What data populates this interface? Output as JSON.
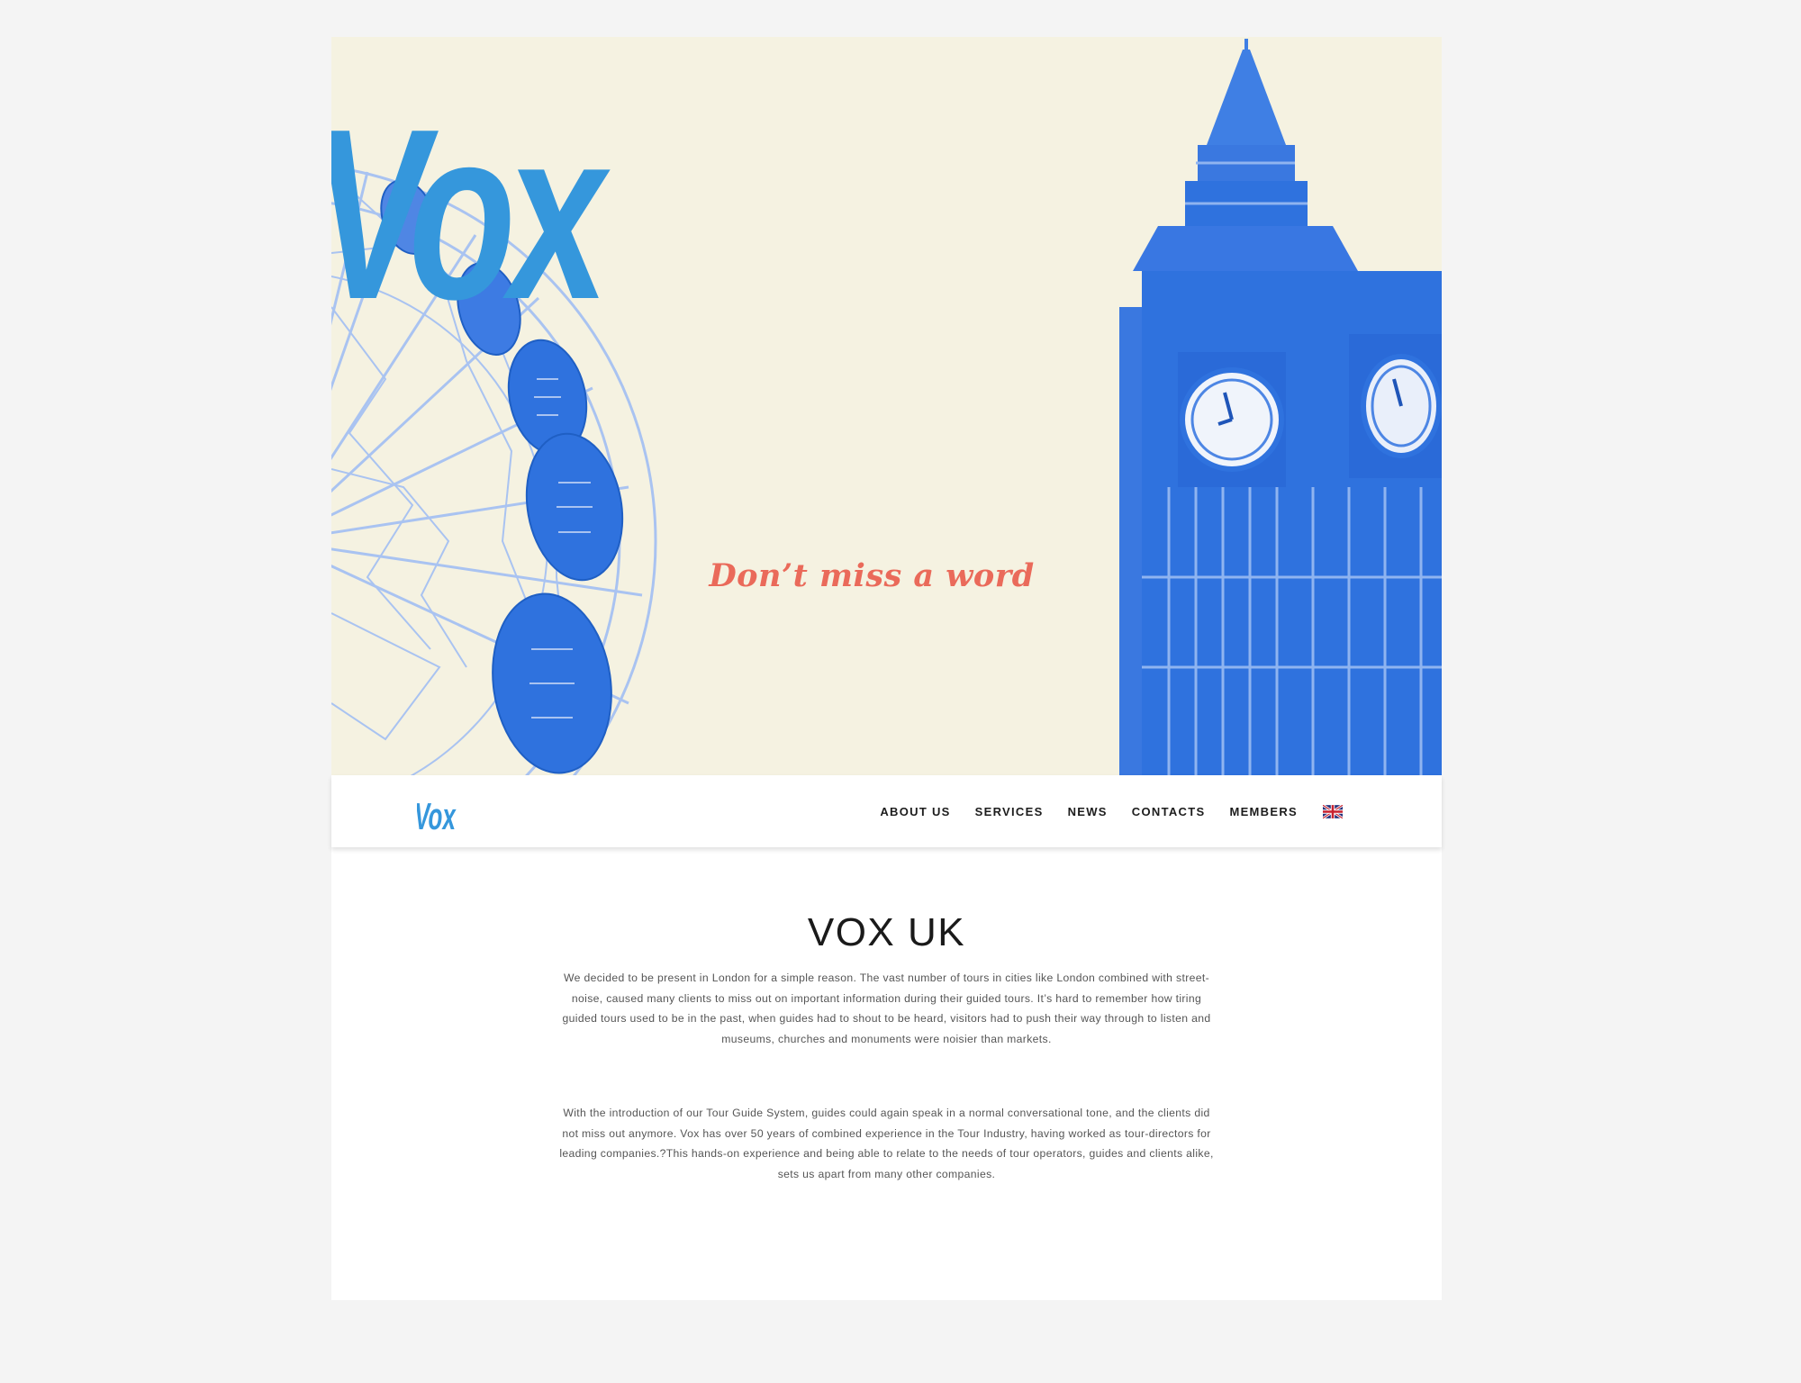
{
  "hero": {
    "logo_text": "Vox",
    "tagline": "Don’t miss a word"
  },
  "nav": {
    "logo_text": "Vox",
    "items": [
      {
        "label": "ABOUT US"
      },
      {
        "label": "SERVICES"
      },
      {
        "label": "NEWS"
      },
      {
        "label": "CONTACTS"
      },
      {
        "label": "MEMBERS"
      }
    ],
    "language_icon": "uk-flag-icon"
  },
  "content": {
    "title": "VOX UK",
    "paragraphs": [
      "We decided to be present in London for a simple reason. The vast number of tours in cities like London combined with street-noise, caused many clients to miss out on important information during their guided tours. It’s hard to remember how tiring guided tours used to be in the past, when guides had to shout to be heard, visitors had to push their way through to listen and museums, churches and monuments were noisier than markets.",
      "With the introduction of our Tour Guide System, guides could again speak in a normal conversational tone, and the clients did not miss out anymore. Vox has over 50 years of combined experience in the Tour Industry, having worked as tour-directors for leading companies.?This hands-on experience and being able to relate to the needs of tour operators, guides and clients alike, sets us apart from many other companies."
    ]
  },
  "colors": {
    "brand_blue": "#3597dc",
    "tagline_red": "#ea6a5a",
    "hero_background": "#f5f2e1",
    "illustration_blue": "#2f72de"
  }
}
